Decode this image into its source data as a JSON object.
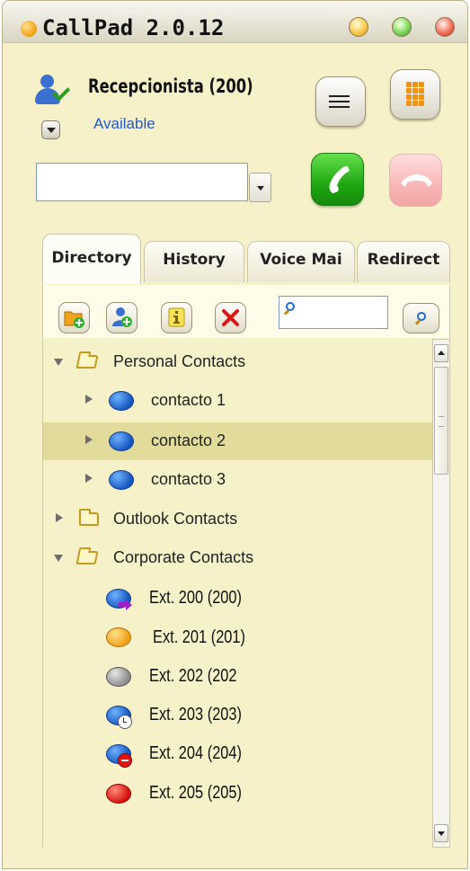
{
  "window": {
    "title": "CallPad 2.0.12",
    "buttons": [
      "minimize",
      "maximize",
      "close"
    ]
  },
  "user": {
    "name": "Recepcionista (200)",
    "status": "Available"
  },
  "dialer": {
    "number_value": "",
    "call_label": "call",
    "hangup_label": "hang up"
  },
  "tabs": [
    {
      "label": "Directory",
      "active": true
    },
    {
      "label": "History",
      "active": false
    },
    {
      "label": "Voice Mai",
      "active": false
    },
    {
      "label": "Redirect",
      "active": false
    }
  ],
  "toolbar": {
    "buttons": [
      "add-group",
      "add-contact",
      "contact-info",
      "delete"
    ],
    "search_value": ""
  },
  "tree": {
    "personal": {
      "label": "Personal Contacts",
      "expanded": true,
      "items": [
        "contacto 1",
        "contacto 2",
        "contacto 3"
      ],
      "selected_index": 1
    },
    "outlook": {
      "label": "Outlook Contacts",
      "expanded": false
    },
    "corporate": {
      "label": "Corporate Contacts",
      "expanded": true,
      "items": [
        {
          "label": "Ext. 200 (200)",
          "status_icon": "blue-forward-bubble"
        },
        {
          "label": "Ext. 201 (201)",
          "status_icon": "orange-bubble"
        },
        {
          "label": "Ext. 202 (202",
          "status_icon": "gray-bubble"
        },
        {
          "label": "Ext. 203 (203)",
          "status_icon": "blue-clock-bubble"
        },
        {
          "label": "Ext. 204 (204)",
          "status_icon": "blue-stop-bubble"
        },
        {
          "label": "Ext. 205 (205)",
          "status_icon": "red-bubble"
        }
      ]
    }
  },
  "colors": {
    "panel_bg": "#f7f1c9",
    "selection": "#e1dc9c",
    "status_link": "#2459c9",
    "call_green": "#1fa712",
    "hangup_pink": "#f8b7b7"
  }
}
